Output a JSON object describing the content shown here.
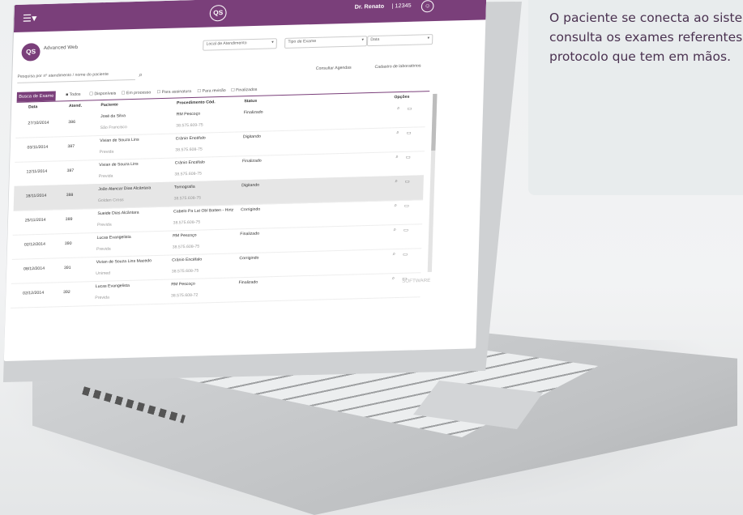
{
  "caption": {
    "text": "O paciente se conecta ao sistema e consulta os exames referentes ao protocolo que tem em mãos."
  },
  "topbar": {
    "brand": "QS",
    "user_name": "Dr. Renato",
    "user_id": "| 12345"
  },
  "app": {
    "logo": "QS",
    "logo_text": "Advanced Web",
    "filters": {
      "local": "Local de Atendimento",
      "tipo": "Tipo de Exame",
      "data": "Data"
    },
    "search_placeholder": "Pesquisa por nº atendimento / nome do paciente",
    "links": {
      "agenda": "Consultar Agendas",
      "reports": "Cadastro de laboratórios"
    },
    "tab_label": "Busca de Exame",
    "status_filters": [
      "Todos",
      "Disponíveis",
      "Em processo",
      "Para assinatura",
      "Para revisão",
      "Finalizados"
    ]
  },
  "table": {
    "headers": {
      "data": "Data",
      "atend": "Atend.",
      "paciente": "Paciente",
      "procedimento": "Procedimento Cód.",
      "status": "Status",
      "opcoes": "Opções"
    },
    "rows": [
      {
        "date": "27/10/2014",
        "atend": "386",
        "patient": "José da Silva",
        "patient_sub": "São Francisco",
        "proc": "RM Pescoço",
        "code": "38.575.609-75",
        "status": "Finalizado"
      },
      {
        "date": "03/11/2014",
        "atend": "387",
        "patient": "Vivian de Souza Lins",
        "patient_sub": "Previda",
        "proc": "Crânio Encéfalo",
        "code": "38.575.608-75",
        "status": "Digitando"
      },
      {
        "date": "12/11/2014",
        "atend": "387",
        "patient": "Vivian de Souza Lins",
        "patient_sub": "Previda",
        "proc": "Crânio Encéfalo",
        "code": "38.575.608-75",
        "status": "Finalizado"
      },
      {
        "date": "18/11/2014",
        "atend": "388",
        "patient": "João Alencar Dias Alcântara",
        "patient_sub": "Golden Cross",
        "proc": "Tomografia",
        "code": "38.575.608-75",
        "status": "Digitando"
      },
      {
        "date": "25/11/2014",
        "atend": "389",
        "patient": "Sueide Dias Alcântara",
        "patient_sub": "Previda",
        "proc": "Cabelo Pa Lat Obl Batten - Hirtz",
        "code": "38.575.608-75",
        "status": "Corrigindo"
      },
      {
        "date": "02/12/2014",
        "atend": "390",
        "patient": "Lucas Evangelista",
        "patient_sub": "Previda",
        "proc": "RM Pescoço",
        "code": "38.575.608-75",
        "status": "Finalizado"
      },
      {
        "date": "08/12/2014",
        "atend": "391",
        "patient": "Vivian de Souza Lins Macedo",
        "patient_sub": "Unimed",
        "proc": "Crânio Encéfalo",
        "code": "38.575.608-75",
        "status": "Corrigindo"
      },
      {
        "date": "02/12/2014",
        "atend": "392",
        "patient": "Lucas Evangelista",
        "patient_sub": "Previda",
        "proc": "RM Pescoço",
        "code": "38.575.608-72",
        "status": "Finalizado"
      }
    ]
  },
  "footer_brand": "SOFTWARE",
  "colors": {
    "brand": "#7a3f7a",
    "caption": "#4a3150"
  }
}
